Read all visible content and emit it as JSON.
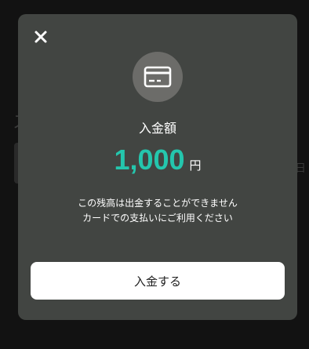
{
  "modal": {
    "close_icon": "close-icon",
    "card_icon": "credit-card-icon",
    "title": "入金額",
    "amount": "1,000",
    "unit": "円",
    "note_line1": "この残高は出金することができません",
    "note_line2": "カードでの支払いにご利用ください",
    "deposit_button_label": "入金する"
  },
  "background": {
    "left_char": "ス",
    "right_char": "日"
  },
  "colors": {
    "modal_bg": "#424542",
    "accent_amount": "#24c6ad",
    "badge_bg": "#6c6c69",
    "button_bg": "#ffffff"
  }
}
